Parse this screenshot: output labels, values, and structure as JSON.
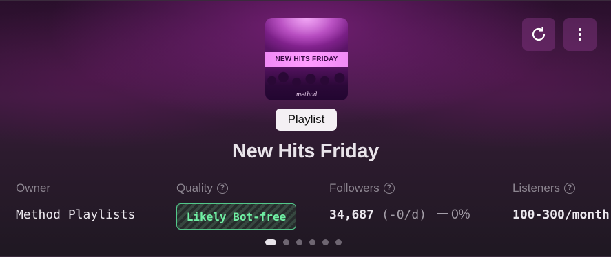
{
  "header": {
    "cover": {
      "banner_text": "NEW HITS FRIDAY",
      "brand_text": "method",
      "accent_color": "#e07ae8"
    },
    "actions": [
      {
        "name": "refresh",
        "icon": "refresh-icon"
      },
      {
        "name": "more",
        "icon": "vertical-ellipsis-icon"
      }
    ]
  },
  "type_label": "Playlist",
  "title": "New Hits Friday",
  "stats": {
    "owner": {
      "label": "Owner",
      "value": "Method Playlists"
    },
    "quality": {
      "label": "Quality",
      "help_icon": "?",
      "badge": "Likely Bot-free",
      "badge_color": "#6ff0a3"
    },
    "followers": {
      "label": "Followers",
      "help_icon": "?",
      "count": "34,687",
      "rate": "(-0/d)",
      "change": "0%"
    },
    "listeners": {
      "label": "Listeners",
      "help_icon": "?",
      "value": "100-300/month"
    }
  },
  "pagination": {
    "total": 6,
    "active_index": 0
  }
}
